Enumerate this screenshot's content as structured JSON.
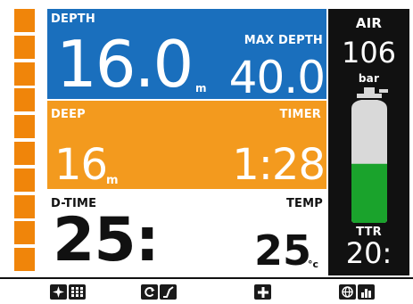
{
  "ascent_bars": {
    "count": 10,
    "color": "#f0850a"
  },
  "depth": {
    "label": "DEPTH",
    "value": "16.0",
    "unit": "m",
    "max_label": "MAX DEPTH",
    "max_value": "40.0"
  },
  "deep": {
    "label": "DEEP",
    "value": "16",
    "unit": "m",
    "timer_label": "TIMER",
    "timer_value": "1:28"
  },
  "dive_time": {
    "label": "D-TIME",
    "value": "25:",
    "temp_label": "TEMP",
    "temp_value": "25",
    "temp_unit": "°c"
  },
  "air": {
    "label": "AIR",
    "value": "106",
    "unit": "bar",
    "tank_fill_fraction": 0.48,
    "fill_color": "#1aa32c",
    "ttr_label": "TTR",
    "ttr_value": "20:"
  },
  "colors": {
    "depth_bg": "#1a6fbd",
    "deep_bg": "#f39a1e",
    "air_bg": "#111111"
  },
  "footer": {
    "buttons": [
      {
        "icon": "compass-icon"
      },
      {
        "icon": "grid-icon"
      },
      {
        "icon": "refresh-icon"
      },
      {
        "icon": "ascent-profile-icon"
      },
      {
        "icon": "plus-icon"
      },
      {
        "icon": "globe-icon"
      },
      {
        "icon": "bar-chart-icon"
      }
    ]
  }
}
